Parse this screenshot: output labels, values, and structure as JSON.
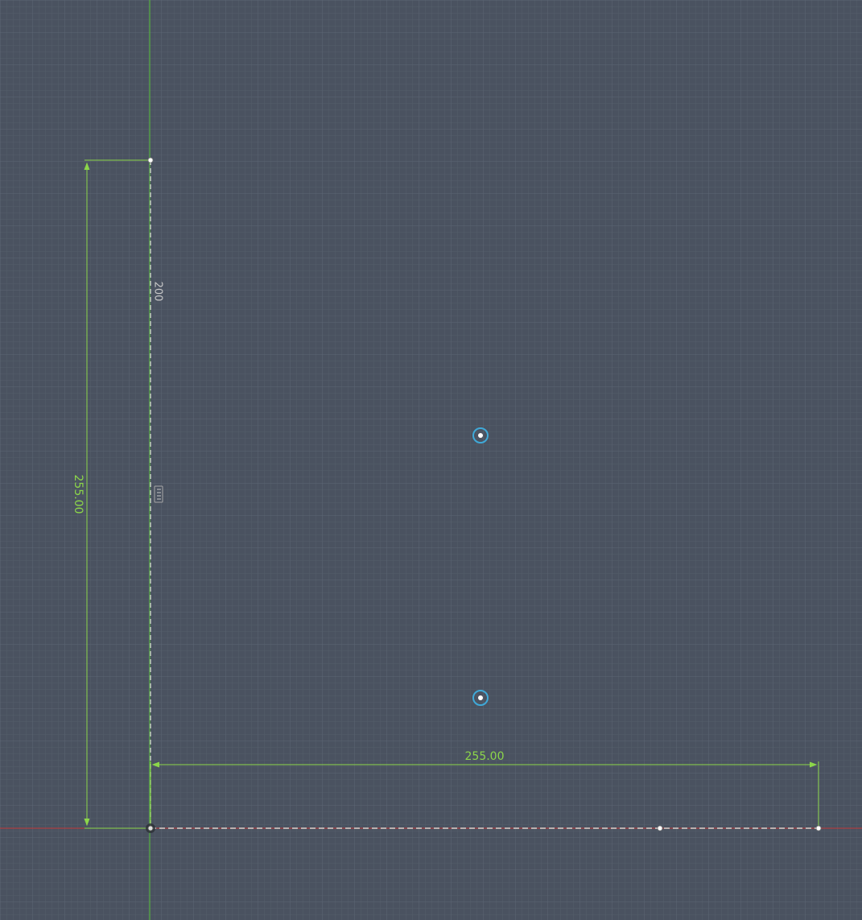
{
  "view": {
    "background_color": "#4a5260",
    "grid_minor_color": "#56606c",
    "grid_major_color": "#5d6774",
    "axis_x_color": "#c23a3a",
    "axis_y_color": "#58c23a",
    "dimension_color": "#8cd64a",
    "construction_color": "#d8d8d8",
    "point_color": "#ffffff",
    "center_ring_color": "#3fa9d8"
  },
  "dimensions": {
    "vertical_value": "255.00",
    "horizontal_value": "255.00",
    "line_label": "200"
  },
  "icons": {
    "constraint_marker": "vertical-constraint-icon"
  }
}
